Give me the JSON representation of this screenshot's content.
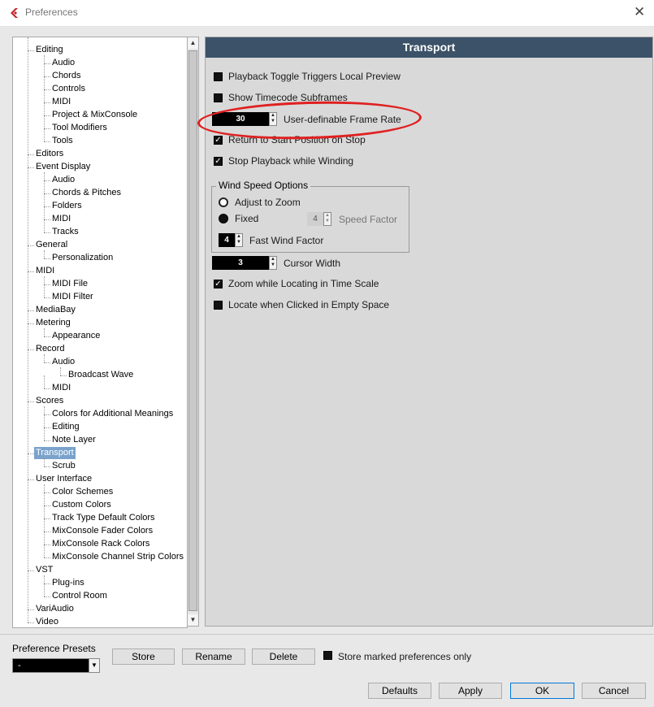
{
  "window": {
    "title": "Preferences",
    "close_glyph": "✕"
  },
  "tree": {
    "items": [
      {
        "label": "Editing",
        "level": 1
      },
      {
        "label": "Audio",
        "level": 2
      },
      {
        "label": "Chords",
        "level": 2
      },
      {
        "label": "Controls",
        "level": 2
      },
      {
        "label": "MIDI",
        "level": 2
      },
      {
        "label": "Project & MixConsole",
        "level": 2
      },
      {
        "label": "Tool Modifiers",
        "level": 2
      },
      {
        "label": "Tools",
        "level": 2
      },
      {
        "label": "Editors",
        "level": 1
      },
      {
        "label": "Event Display",
        "level": 1
      },
      {
        "label": "Audio",
        "level": 2
      },
      {
        "label": "Chords & Pitches",
        "level": 2
      },
      {
        "label": "Folders",
        "level": 2
      },
      {
        "label": "MIDI",
        "level": 2
      },
      {
        "label": "Tracks",
        "level": 2
      },
      {
        "label": "General",
        "level": 1
      },
      {
        "label": "Personalization",
        "level": 2
      },
      {
        "label": "MIDI",
        "level": 1
      },
      {
        "label": "MIDI File",
        "level": 2
      },
      {
        "label": "MIDI Filter",
        "level": 2
      },
      {
        "label": "MediaBay",
        "level": 1
      },
      {
        "label": "Metering",
        "level": 1
      },
      {
        "label": "Appearance",
        "level": 2
      },
      {
        "label": "Record",
        "level": 1
      },
      {
        "label": "Audio",
        "level": 2
      },
      {
        "label": "Broadcast Wave",
        "level": 3
      },
      {
        "label": "MIDI",
        "level": 2
      },
      {
        "label": "Scores",
        "level": 1
      },
      {
        "label": "Colors for Additional Meanings",
        "level": 2
      },
      {
        "label": "Editing",
        "level": 2
      },
      {
        "label": "Note Layer",
        "level": 2
      },
      {
        "label": "Transport",
        "level": 1,
        "selected": true
      },
      {
        "label": "Scrub",
        "level": 2
      },
      {
        "label": "User Interface",
        "level": 1
      },
      {
        "label": "Color Schemes",
        "level": 2
      },
      {
        "label": "Custom Colors",
        "level": 2
      },
      {
        "label": "Track Type Default Colors",
        "level": 2
      },
      {
        "label": "MixConsole Fader Colors",
        "level": 2
      },
      {
        "label": "MixConsole Rack Colors",
        "level": 2
      },
      {
        "label": "MixConsole Channel Strip Colors",
        "level": 2
      },
      {
        "label": "VST",
        "level": 1
      },
      {
        "label": "Plug-ins",
        "level": 2
      },
      {
        "label": "Control Room",
        "level": 2
      },
      {
        "label": "VariAudio",
        "level": 1
      },
      {
        "label": "Video",
        "level": 1
      }
    ]
  },
  "panel": {
    "title": "Transport",
    "options": {
      "playback_toggle": {
        "label": "Playback Toggle Triggers Local Preview",
        "checked": false
      },
      "show_subframes": {
        "label": "Show Timecode Subframes",
        "checked": false
      },
      "frame_rate": {
        "label": "User-definable Frame Rate",
        "value": "30"
      },
      "return_to_start": {
        "label": "Return to Start Position on Stop",
        "checked": true
      },
      "stop_winding": {
        "label": "Stop Playback while Winding",
        "checked": true
      },
      "zoom_locating": {
        "label": "Zoom while Locating in Time Scale",
        "checked": true
      },
      "locate_empty": {
        "label": "Locate when Clicked in Empty Space",
        "checked": false
      }
    },
    "wind": {
      "title": "Wind Speed Options",
      "adjust_to_zoom": "Adjust to Zoom",
      "fixed": "Fixed",
      "speed_factor_label": "Speed Factor",
      "speed_factor_value": "4",
      "fast_wind_label": "Fast Wind Factor",
      "fast_wind_value": "4"
    },
    "cursor": {
      "label": "Cursor Width",
      "value": "3"
    }
  },
  "footer": {
    "presets_label": "Preference Presets",
    "preset_value": "-",
    "store": "Store",
    "rename": "Rename",
    "delete": "Delete",
    "store_marked": "Store marked preferences only",
    "defaults": "Defaults",
    "apply": "Apply",
    "ok": "OK",
    "cancel": "Cancel"
  },
  "colors": {
    "header_bg": "#3b5268",
    "selection": "#7aa2cc",
    "annotation": "#e02020"
  }
}
